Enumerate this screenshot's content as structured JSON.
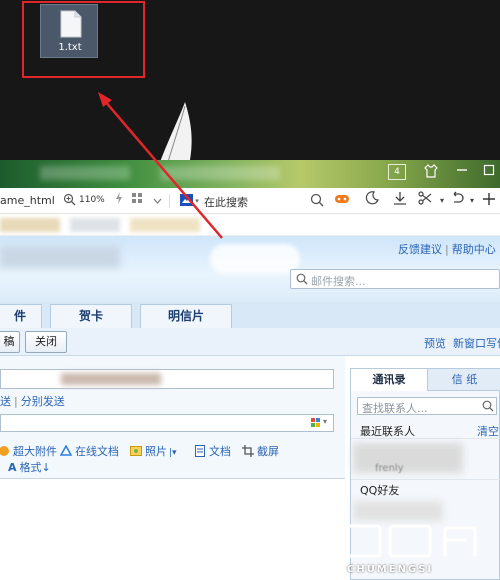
{
  "desktop": {
    "file_name": "1.txt"
  },
  "title_bar": {
    "tab_count": "4"
  },
  "address_bar": {
    "url": "ame_html",
    "zoom": "110%",
    "search_placeholder": "在此搜索"
  },
  "mail_header": {
    "feedback": "反馈建议",
    "help": "帮助中心",
    "separator": "|",
    "search_placeholder": "邮件搜索..."
  },
  "nav_tabs": [
    {
      "label": "件"
    },
    {
      "label": "贺卡"
    },
    {
      "label": "明信片"
    }
  ],
  "toolbar": {
    "draft_label": "稿",
    "close_label": "关闭",
    "preview_label": "预览",
    "new_window_label": "新窗口写信"
  },
  "compose": {
    "send_links": [
      "送",
      "分别发送"
    ],
    "separator": "|",
    "attachments": [
      {
        "label": "超大附件",
        "icon": "large-attachment-icon"
      },
      {
        "label": "在线文档",
        "icon": "online-doc-icon"
      },
      {
        "label": "照片",
        "icon": "photo-icon"
      },
      {
        "label": "文档",
        "icon": "document-icon"
      },
      {
        "label": "截屏",
        "icon": "screenshot-icon"
      }
    ],
    "format_label": "格式"
  },
  "contacts_panel": {
    "tab_contacts": "通讯录",
    "tab_paper": "信 纸",
    "search_placeholder": "查找联系人...",
    "recent_label": "最近联系人",
    "clear_label": "清空",
    "recent_name_partial": "frenly",
    "qq_label": "QQ好友"
  },
  "watermark": {
    "text": "CHUMENGSI"
  },
  "colors": {
    "highlight_box": "#e0262a",
    "link": "#2a64b5",
    "title_bar": "#3f8e3f",
    "header_bg": "#cfe6fa"
  }
}
